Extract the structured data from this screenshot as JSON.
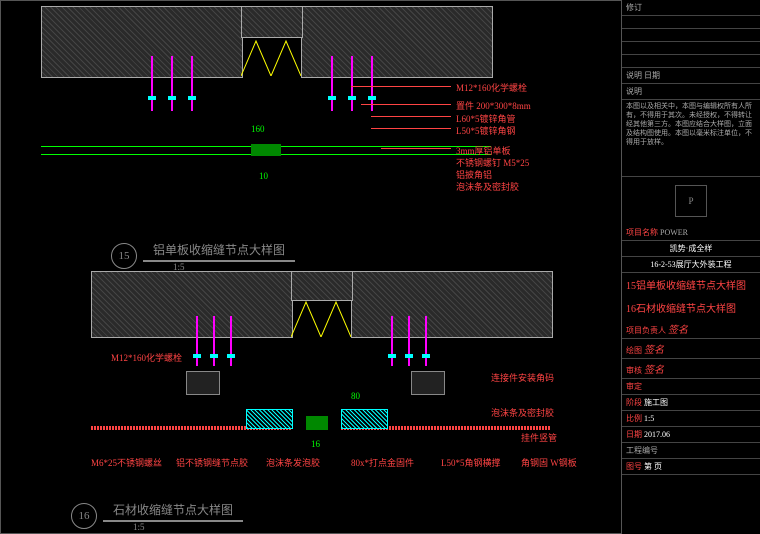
{
  "d15": {
    "number": "15",
    "title": "铝单板收缩缝节点大样图",
    "scale": "1:5",
    "dim1": "160",
    "dim2": "10",
    "annos": {
      "a1": "M12*160化学螺栓",
      "a2": "置件 200*300*8mm",
      "a3": "L60*5镀锌角管",
      "a4": "L50*5镀锌角钢",
      "a5": "3mm厚铝单板",
      "a6": "不锈钢螺钉 M5*25",
      "a7": "铝披角铝",
      "a8": "泡沫条及密封胶"
    }
  },
  "d16": {
    "number": "16",
    "title": "石材收缩缝节点大样图",
    "scale": "1:5",
    "dim1": "80",
    "dim2": "16",
    "annos": {
      "b1": "M12*160化学螺栓",
      "b2": "连接件安装角码",
      "b3": "泡沫条及密封胶",
      "b4": "M6*25不锈钢螺丝",
      "b5": "铝不锈钢缝节点胶",
      "b6": "泡沫条发泡胶",
      "b7": "80x*打点金固件",
      "b8": "L50*5角钢横撑",
      "b9": "挂件竖管",
      "b10": "角钢固 W钢板"
    }
  },
  "tblock": {
    "rev_hdr": "修订",
    "rev_cols": "说明  日期",
    "notes_hdr": "说明",
    "notes": "本图以及相关中，本图与编辑权所有人所有，不得用于其次。未经授权，不得转让经其他第三方。本图应结合大样图，立面及结构图使用。本图以毫米标注单位，不得用于放样。",
    "logo": "P",
    "proj_lbl": "项目名称",
    "proj": "POWER",
    "subproj1": "凯势·成全样",
    "subproj2": "16-2-53展厅大外装工程",
    "dwg1": "15铝单板收缩缝节点大样图",
    "dwg2": "16石材收缩缝节点大样图",
    "design_lbl": "项目负责人",
    "design_sig": "签名",
    "draw_lbl": "绘图",
    "check_lbl": "审核",
    "appr_lbl": "审定",
    "stage_lbl": "阶段",
    "stage": "施工图",
    "scale_lbl": "比例",
    "scale": "1:5",
    "date_lbl": "日期",
    "date": "2017.06",
    "no_lbl": "工程编号",
    "sheet_lbl": "图号",
    "sheet": "第  页"
  }
}
